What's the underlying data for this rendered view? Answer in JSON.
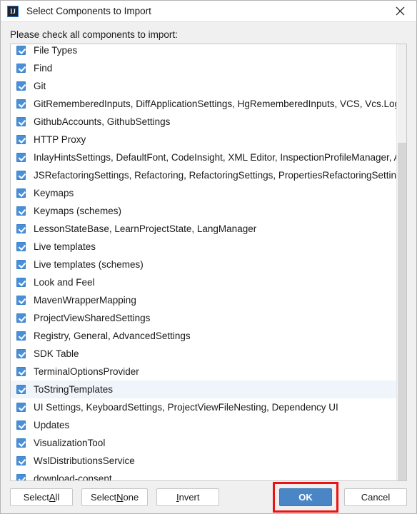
{
  "window": {
    "title": "Select Components to Import",
    "icon": "IJ",
    "close_icon": "close-icon"
  },
  "prompt": "Please check all components to import:",
  "list": {
    "items": [
      {
        "label": "File Types",
        "checked": true,
        "selected": false
      },
      {
        "label": "Find",
        "checked": true,
        "selected": false
      },
      {
        "label": "Git",
        "checked": true,
        "selected": false
      },
      {
        "label": "GitRememberedInputs, DiffApplicationSettings, HgRememberedInputs, VCS, Vcs.Log.App",
        "checked": true,
        "selected": false
      },
      {
        "label": "GithubAccounts, GithubSettings",
        "checked": true,
        "selected": false
      },
      {
        "label": "HTTP Proxy",
        "checked": true,
        "selected": false
      },
      {
        "label": "InlayHintsSettings, DefaultFont, CodeInsight, XML Editor, InspectionProfileManager, Andro",
        "checked": true,
        "selected": false
      },
      {
        "label": "JSRefactoringSettings, Refactoring, RefactoringSettings, PropertiesRefactoringSettings",
        "checked": true,
        "selected": false
      },
      {
        "label": "Keymaps",
        "checked": true,
        "selected": false
      },
      {
        "label": "Keymaps (schemes)",
        "checked": true,
        "selected": false
      },
      {
        "label": "LessonStateBase, LearnProjectState, LangManager",
        "checked": true,
        "selected": false
      },
      {
        "label": "Live templates",
        "checked": true,
        "selected": false
      },
      {
        "label": "Live templates (schemes)",
        "checked": true,
        "selected": false
      },
      {
        "label": "Look and Feel",
        "checked": true,
        "selected": false
      },
      {
        "label": "MavenWrapperMapping",
        "checked": true,
        "selected": false
      },
      {
        "label": "ProjectViewSharedSettings",
        "checked": true,
        "selected": false
      },
      {
        "label": "Registry, General, AdvancedSettings",
        "checked": true,
        "selected": false
      },
      {
        "label": "SDK Table",
        "checked": true,
        "selected": false
      },
      {
        "label": "TerminalOptionsProvider",
        "checked": true,
        "selected": false
      },
      {
        "label": "ToStringTemplates",
        "checked": true,
        "selected": true
      },
      {
        "label": "UI Settings, KeyboardSettings, ProjectViewFileNesting, Dependency UI",
        "checked": true,
        "selected": false
      },
      {
        "label": "Updates",
        "checked": true,
        "selected": false
      },
      {
        "label": "VisualizationTool",
        "checked": true,
        "selected": false
      },
      {
        "label": "WslDistributionsService",
        "checked": true,
        "selected": false
      },
      {
        "label": "download-consent",
        "checked": true,
        "selected": false
      }
    ]
  },
  "buttons": {
    "select_all": {
      "pre": "Select ",
      "mnemonic": "A",
      "post": "ll"
    },
    "select_none": {
      "pre": "Select ",
      "mnemonic": "N",
      "post": "one"
    },
    "invert": {
      "pre": "",
      "mnemonic": "I",
      "post": "nvert"
    },
    "ok": "OK",
    "cancel": "Cancel"
  },
  "colors": {
    "accent": "#4a86c5",
    "checkbox": "#4a90d9",
    "selection": "#eff5fb",
    "annotation": "#ee1111",
    "window_bg": "#f0f0f0"
  }
}
